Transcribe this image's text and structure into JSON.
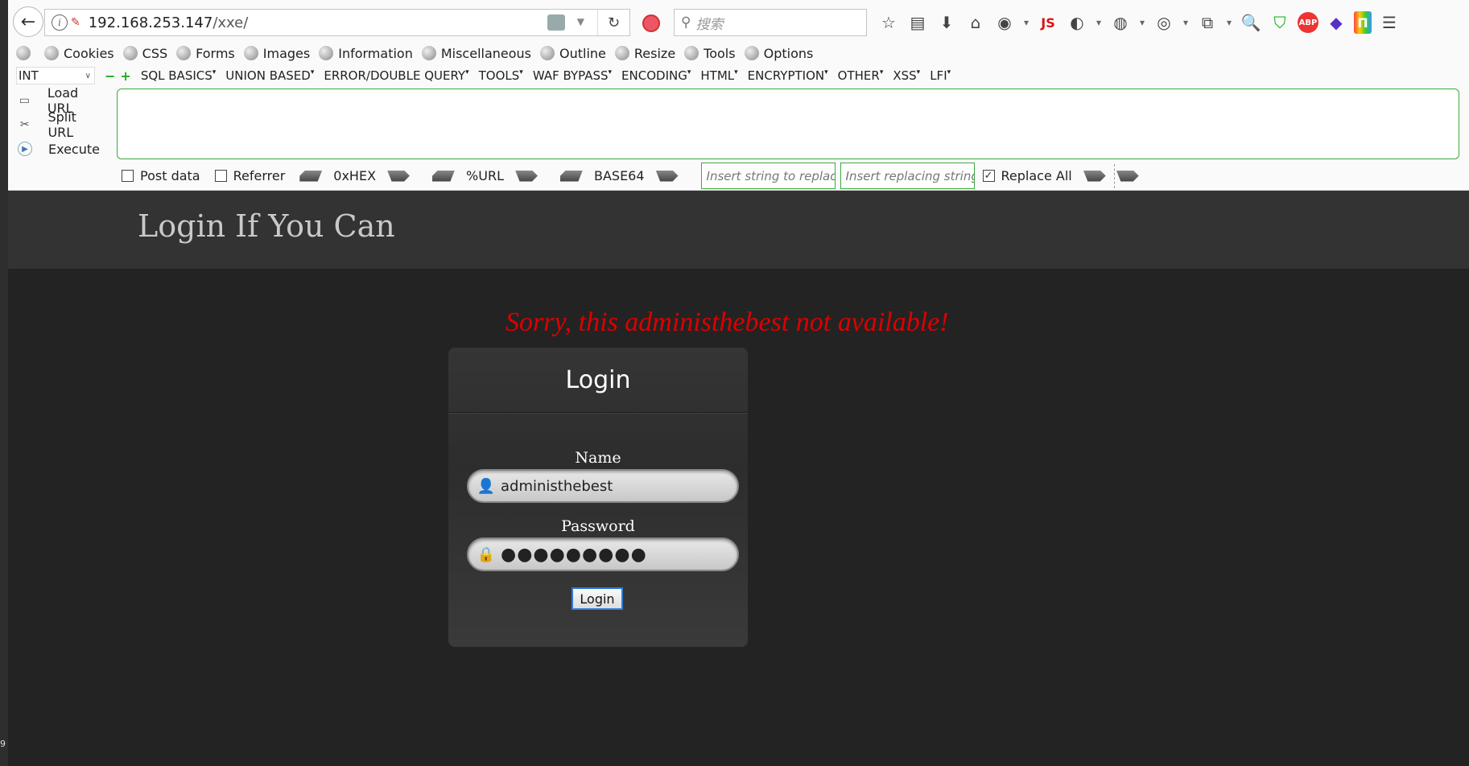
{
  "browser": {
    "url_host": "192.168.253.147",
    "url_path": "/xxe/",
    "search_placeholder": "搜索"
  },
  "devtoolbar": {
    "items": [
      "Cookies",
      "CSS",
      "Forms",
      "Images",
      "Information",
      "Miscellaneous",
      "Outline",
      "Resize",
      "Tools",
      "Options"
    ]
  },
  "hackbar": {
    "select_value": "INT",
    "menus": [
      "SQL BASICS",
      "UNION BASED",
      "ERROR/DOUBLE QUERY",
      "TOOLS",
      "WAF BYPASS",
      "ENCODING",
      "HTML",
      "ENCRYPTION",
      "OTHER",
      "XSS",
      "LFI"
    ],
    "load_url": "Load URL",
    "split_url": "Split URL",
    "execute": "Execute",
    "post_data": "Post data",
    "referrer": "Referrer",
    "hex": "0xHEX",
    "url_enc": "%URL",
    "base64": "BASE64",
    "replace_placeholder": "Insert string to replace",
    "replacing_placeholder": "Insert replacing string",
    "replace_all": "Replace All",
    "replace_all_checked": true
  },
  "page": {
    "title": "Login If You Can",
    "error": "Sorry, this administhebest not available!",
    "login_title": "Login",
    "name_label": "Name",
    "name_value": "administhebest",
    "password_label": "Password",
    "password_mask": "●●●●●●●●●",
    "login_button": "Login"
  },
  "side": {
    "marker": "9"
  }
}
